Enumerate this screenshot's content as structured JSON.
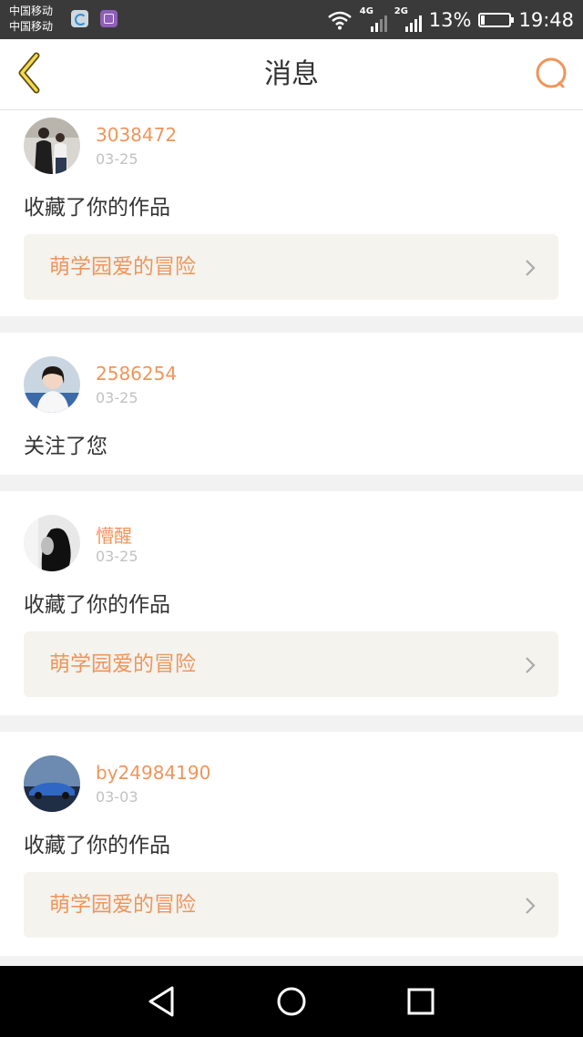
{
  "status_bar": {
    "carrier_1": "中国移动",
    "carrier_2": "中国移动",
    "network_1": "4G",
    "network_2": "2G",
    "battery": "13%",
    "battery_level": 0.13,
    "time": "19:48"
  },
  "header": {
    "title": "消息"
  },
  "colors": {
    "accent": "#f0955a",
    "card_link_bg": "#f4f3ee"
  },
  "notifications": [
    {
      "user": "3038472",
      "date": "03-25",
      "action": "收藏了你的作品",
      "work": "萌学园爱的冒险"
    },
    {
      "user": "2586254",
      "date": "03-25",
      "action": "关注了您"
    },
    {
      "user": "懵醒",
      "date": "03-25",
      "action": "收藏了你的作品",
      "work": "萌学园爱的冒险"
    },
    {
      "user": "by24984190",
      "date": "03-03",
      "action": "收藏了你的作品",
      "work": "萌学园爱的冒险"
    }
  ],
  "icons": {
    "back": "back-chevron-icon",
    "search": "search-icon",
    "nav_back": "triangle-back-icon",
    "nav_home": "circle-home-icon",
    "nav_recents": "square-recents-icon"
  }
}
